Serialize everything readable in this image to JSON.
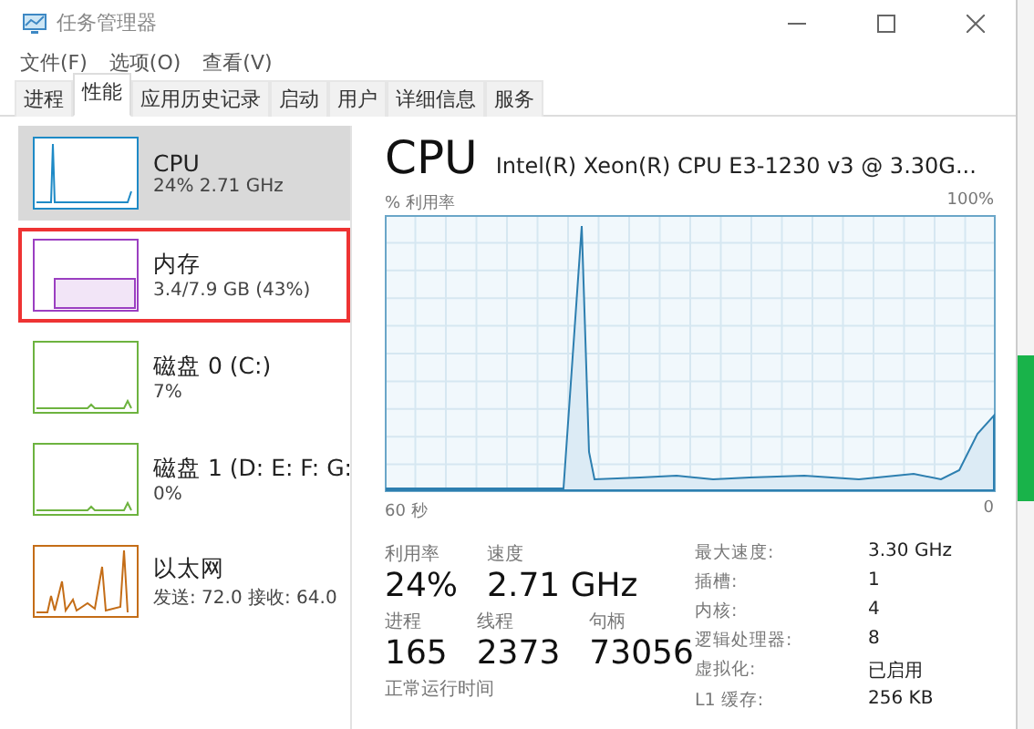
{
  "window": {
    "title": "任务管理器"
  },
  "menu": [
    "文件(F)",
    "选项(O)",
    "查看(V)"
  ],
  "tabs": [
    {
      "label": "进程",
      "selected": false
    },
    {
      "label": "性能",
      "selected": true
    },
    {
      "label": "应用历史记录",
      "selected": false
    },
    {
      "label": "启动",
      "selected": false
    },
    {
      "label": "用户",
      "selected": false
    },
    {
      "label": "详细信息",
      "selected": false
    },
    {
      "label": "服务",
      "selected": false
    }
  ],
  "sidebar": {
    "items": [
      {
        "kind": "cpu",
        "name": "CPU",
        "detail": "24% 2.71 GHz",
        "color": "#1e8ac6",
        "selected": true,
        "outlined": false
      },
      {
        "kind": "memory",
        "name": "内存",
        "detail": "3.4/7.9 GB (43%)",
        "color": "#9b3fc1",
        "selected": false,
        "outlined": true
      },
      {
        "kind": "disk",
        "name": "磁盘 0 (C:)",
        "detail": "7%",
        "color": "#6db33f",
        "selected": false,
        "outlined": false
      },
      {
        "kind": "disk",
        "name": "磁盘 1 (D: E: F: G:",
        "detail": "0%",
        "color": "#6db33f",
        "selected": false,
        "outlined": false
      },
      {
        "kind": "network",
        "name": "以太网",
        "detail": "发送: 72.0 接收: 64.0",
        "color": "#c46d17",
        "selected": false,
        "outlined": false
      }
    ]
  },
  "detail": {
    "title": "CPU",
    "model": "Intel(R) Xeon(R) CPU E3-1230 v3 @ 3.30G...",
    "axis_label": "% 利用率",
    "axis_max": "100%",
    "time_span": "60 秒",
    "axis_min": "0",
    "stats": [
      {
        "label": "利用率",
        "value": "24%"
      },
      {
        "label": "速度",
        "value": "2.71 GHz"
      }
    ],
    "counts": [
      {
        "label": "进程",
        "value": "165"
      },
      {
        "label": "线程",
        "value": "2373"
      },
      {
        "label": "句柄",
        "value": "73056"
      }
    ],
    "uptime_label": "正常运行时间",
    "specs": [
      {
        "label": "最大速度:",
        "value": "3.30 GHz"
      },
      {
        "label": "插槽:",
        "value": "1"
      },
      {
        "label": "内核:",
        "value": "4"
      },
      {
        "label": "逻辑处理器:",
        "value": "8"
      },
      {
        "label": "虚拟化:",
        "value": "已启用"
      },
      {
        "label": "L1 缓存:",
        "value": "256 KB"
      }
    ]
  }
}
